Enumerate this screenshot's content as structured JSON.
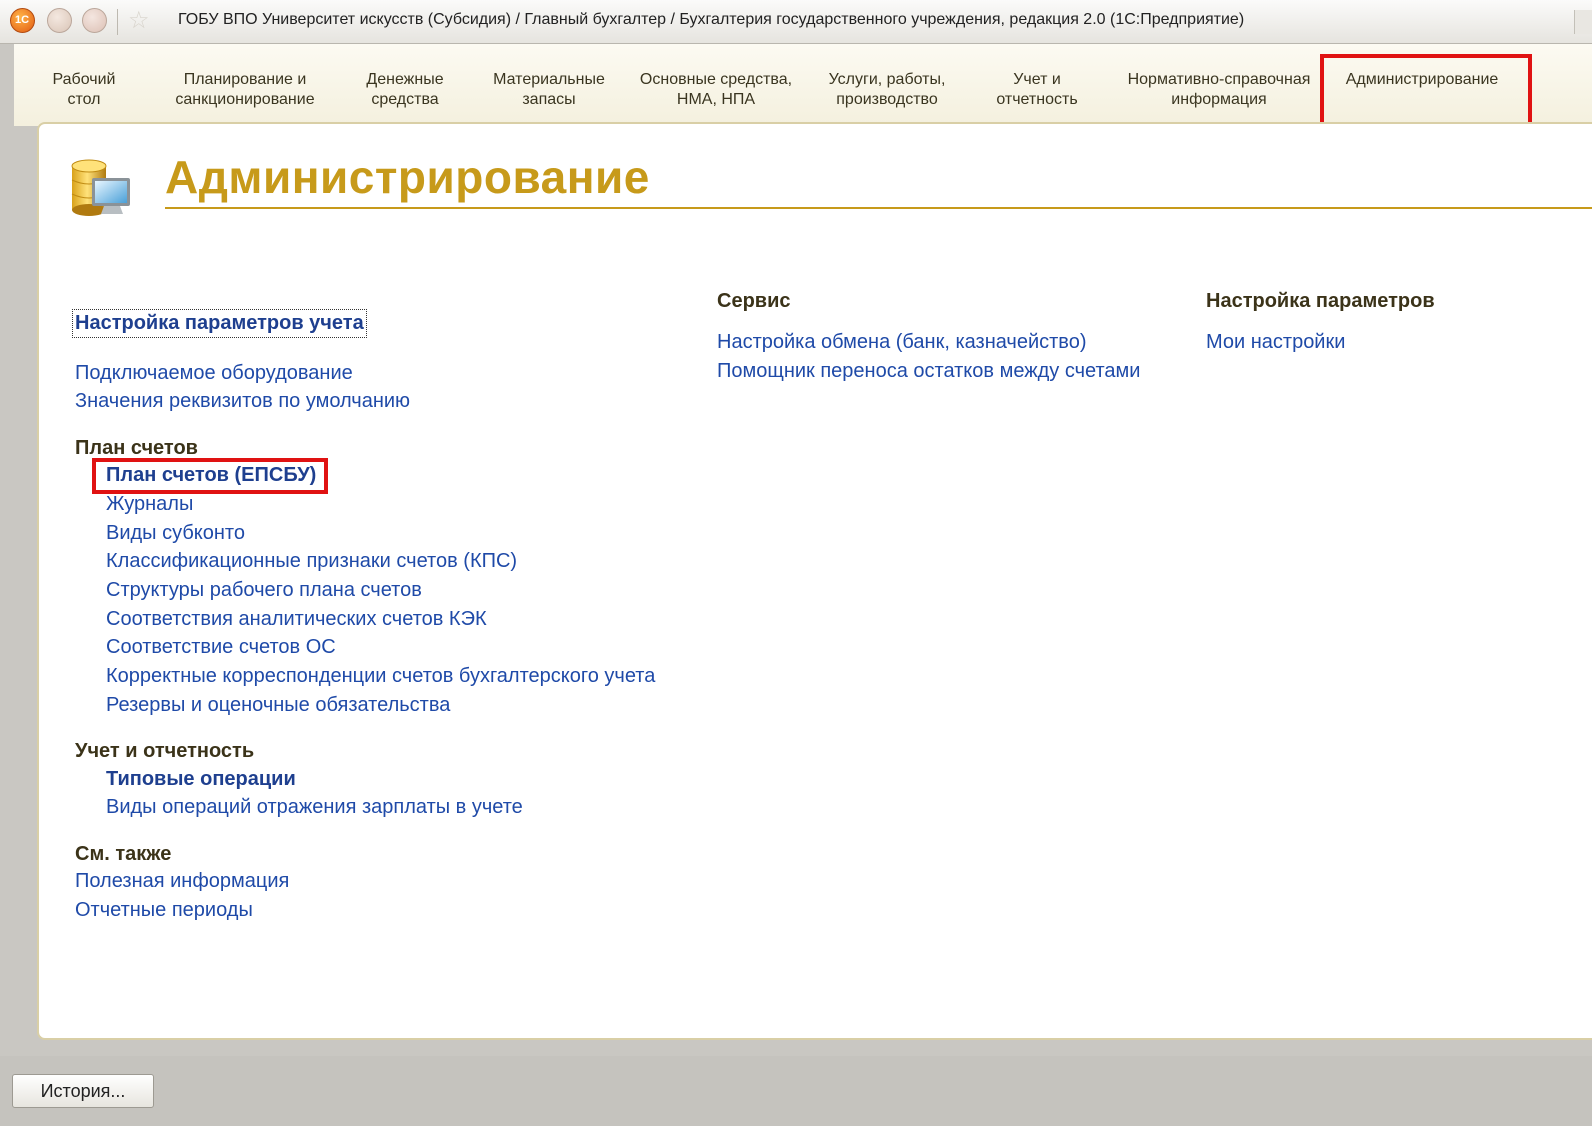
{
  "window": {
    "title": "ГОБУ ВПО Университет искусств (Субсидия) / Главный бухгалтер / Бухгалтерия государственного учреждения, редакция 2.0  (1С:Предприятие)",
    "logo_text": "1C",
    "star_glyph": "☆"
  },
  "sections": [
    {
      "line1": "Рабочий",
      "line2": "стол"
    },
    {
      "line1": "Планирование и",
      "line2": "санкционирование"
    },
    {
      "line1": "Денежные",
      "line2": "средства"
    },
    {
      "line1": "Материальные",
      "line2": "запасы"
    },
    {
      "line1": "Основные средства,",
      "line2": "НМА, НПА"
    },
    {
      "line1": "Услуги, работы,",
      "line2": "производство"
    },
    {
      "line1": "Учет и",
      "line2": "отчетность"
    },
    {
      "line1": "Нормативно-справочная",
      "line2": "информация"
    },
    {
      "line1": "Администрирование",
      "line2": ""
    }
  ],
  "page": {
    "title": "Администрирование"
  },
  "left_column": {
    "settings_link": "Настройка параметров учета",
    "equipment_link": "Подключаемое оборудование",
    "defaults_link": "Значения реквизитов по умолчанию",
    "chart_group": {
      "title": "План счетов",
      "items": [
        "План счетов (ЕПСБУ)",
        "Журналы",
        "Виды субконто",
        "Классификационные признаки счетов (КПС)",
        "Структуры рабочего плана счетов",
        "Соответствия аналитических счетов КЭК",
        "Соответствие счетов ОС",
        "Корректные корреспонденции счетов бухгалтерского учета",
        "Резервы и оценочные обязательства"
      ]
    },
    "reporting_group": {
      "title": "Учет и отчетность",
      "items": [
        "Типовые операции",
        "Виды операций отражения зарплаты в учете"
      ]
    },
    "see_also_group": {
      "title": "См. также",
      "items": [
        "Полезная информация",
        "Отчетные периоды"
      ]
    }
  },
  "service_column": {
    "title": "Сервис",
    "items": [
      "Настройка обмена (банк, казначейство)",
      "Помощник переноса остатков между счетами"
    ]
  },
  "params_column": {
    "title": "Настройка параметров",
    "items": [
      "Мои настройки"
    ]
  },
  "footer": {
    "history_button": "История..."
  },
  "colors": {
    "title_gold": "#c79a1a",
    "link_blue": "#1f4aa8",
    "highlight_red": "#e01212"
  }
}
